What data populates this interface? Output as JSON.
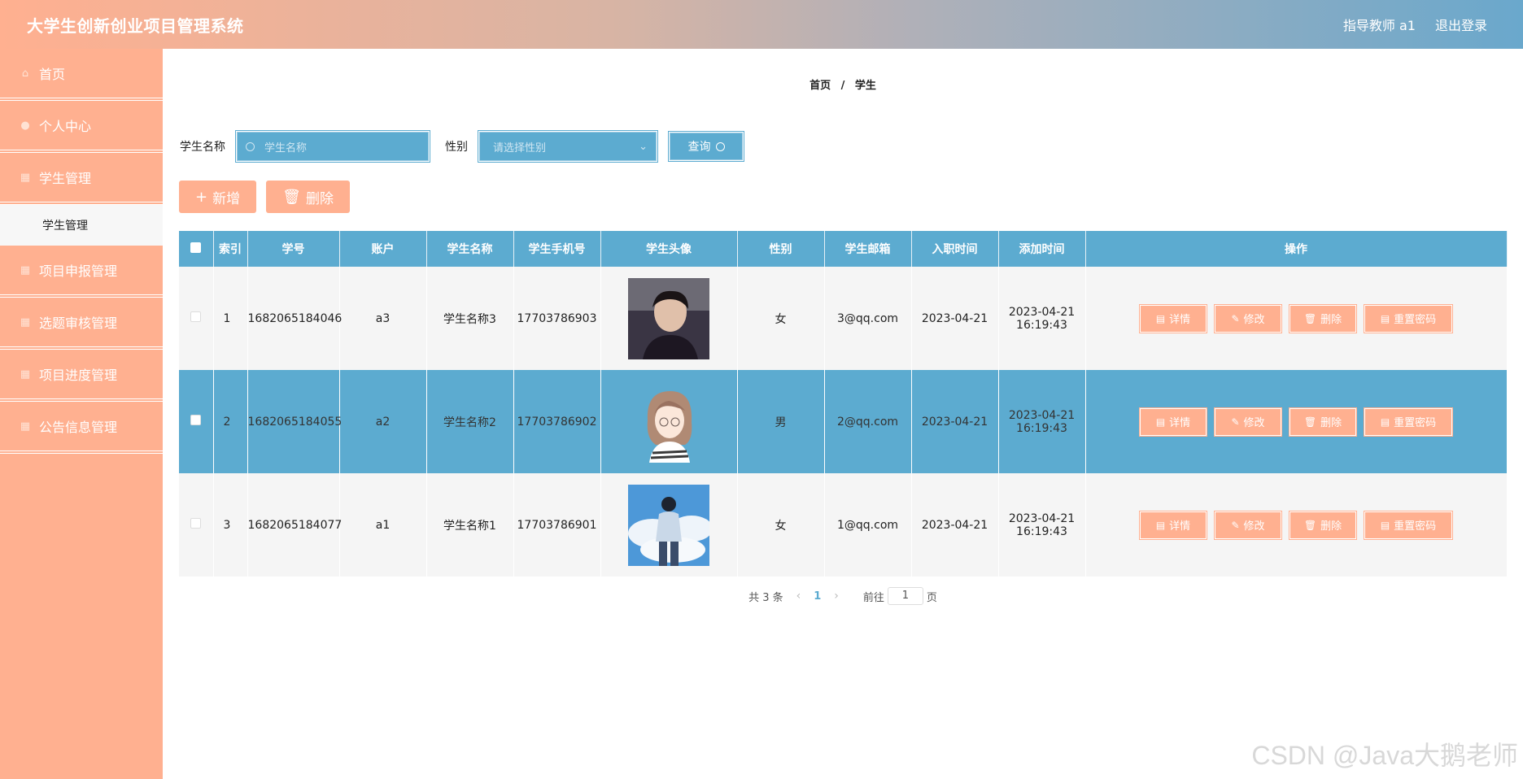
{
  "header": {
    "title": "大学生创新创业项目管理系统",
    "user": "指导教师 a1",
    "logout": "退出登录"
  },
  "sidebar": {
    "items": [
      {
        "label": "首页",
        "icon": "home-icon"
      },
      {
        "label": "个人中心",
        "icon": "user-icon"
      },
      {
        "label": "学生管理",
        "icon": "grid-icon"
      },
      {
        "label": "项目申报管理",
        "icon": "grid-icon"
      },
      {
        "label": "选题审核管理",
        "icon": "grid-icon"
      },
      {
        "label": "项目进度管理",
        "icon": "grid-icon"
      },
      {
        "label": "公告信息管理",
        "icon": "grid-icon"
      }
    ],
    "submenu": {
      "label": "学生管理"
    }
  },
  "breadcrumb": {
    "home": "首页",
    "sep": "/",
    "current": "学生"
  },
  "filters": {
    "name_label": "学生名称",
    "name_placeholder": "学生名称",
    "gender_label": "性别",
    "gender_placeholder": "请选择性别",
    "query_label": "查询"
  },
  "actions": {
    "add": "新增",
    "delete": "删除"
  },
  "table": {
    "headers": [
      "索引",
      "学号",
      "账户",
      "学生名称",
      "学生手机号",
      "学生头像",
      "性别",
      "学生邮箱",
      "入职时间",
      "添加时间",
      "操作"
    ],
    "rows": [
      {
        "index": "1",
        "student_no": "1682065184046",
        "account": "a3",
        "name": "学生名称3",
        "phone": "17703786903",
        "gender": "女",
        "email": "3@qq.com",
        "join_date": "2023-04-21",
        "added": "2023-04-21 16:19:43"
      },
      {
        "index": "2",
        "student_no": "1682065184055",
        "account": "a2",
        "name": "学生名称2",
        "phone": "17703786902",
        "gender": "男",
        "email": "2@qq.com",
        "join_date": "2023-04-21",
        "added": "2023-04-21 16:19:43"
      },
      {
        "index": "3",
        "student_no": "1682065184077",
        "account": "a1",
        "name": "学生名称1",
        "phone": "17703786901",
        "gender": "女",
        "email": "1@qq.com",
        "join_date": "2023-04-21",
        "added": "2023-04-21 16:19:43"
      }
    ],
    "ops": {
      "detail": "详情",
      "edit": "修改",
      "delete": "删除",
      "reset": "重置密码"
    }
  },
  "pager": {
    "total": "共 3 条",
    "page": "1",
    "goto": "前往",
    "page_input": "1",
    "page_suffix": "页"
  },
  "watermark": "CSDN @Java大鹅老师",
  "colors": {
    "accent": "#ffb090",
    "primary": "#5cabd0"
  }
}
